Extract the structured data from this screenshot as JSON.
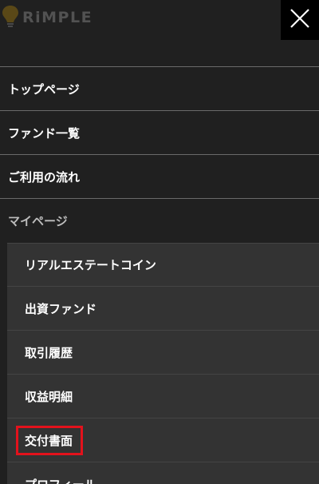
{
  "logo": {
    "text": "RiMPLE",
    "icon": "lightbulb-icon"
  },
  "close": {
    "icon": "close-icon"
  },
  "menu": {
    "items": [
      {
        "label": "トップページ"
      },
      {
        "label": "ファンド一覧"
      },
      {
        "label": "ご利用の流れ"
      }
    ],
    "section_label": "マイページ",
    "submenu": [
      {
        "label": "リアルエステートコイン"
      },
      {
        "label": "出資ファンド"
      },
      {
        "label": "取引履歴"
      },
      {
        "label": "収益明細"
      },
      {
        "label": "交付書面",
        "highlighted": true
      },
      {
        "label": "プロフィール"
      }
    ]
  },
  "colors": {
    "background": "#202020",
    "submenu_background": "#333333",
    "divider": "#6a6a6a",
    "highlight": "#e3121c",
    "close_background": "#000000"
  }
}
